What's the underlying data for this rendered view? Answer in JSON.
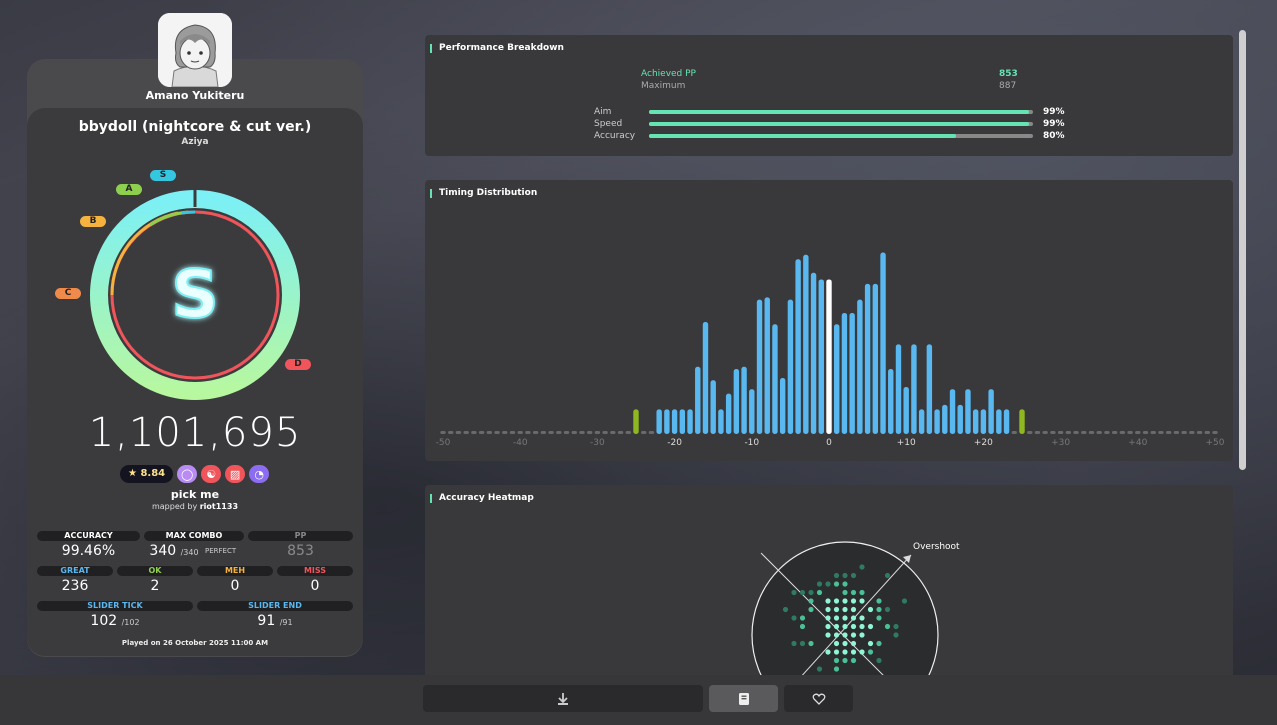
{
  "user": {
    "name": "Amano Yukiteru"
  },
  "beatmap": {
    "title": "bbydoll (nightcore & cut ver.)",
    "artist": "Aziya",
    "difficulty": "pick me",
    "mapped_by_prefix": "mapped by ",
    "mapper": "riot1133",
    "star_rating": "★ 8.84"
  },
  "grade": {
    "letter": "S",
    "labels": [
      "A",
      "S",
      "B",
      "C",
      "D"
    ],
    "colors": {
      "S": "#35c6e0",
      "A": "#8ed04e",
      "B": "#f5b23f",
      "C": "#f08a4b",
      "D": "#f0555b"
    }
  },
  "score": "1,101,695",
  "mods": [
    {
      "name": "mod-hidden-icon",
      "glyph": "◯",
      "color": "#b98cf5"
    },
    {
      "name": "mod-nightcore-icon",
      "glyph": "☯",
      "color": "#f0555b"
    },
    {
      "name": "mod-hardrock-icon",
      "glyph": "▨",
      "color": "#f0555b"
    },
    {
      "name": "mod-rate-icon",
      "glyph": "◔",
      "color": "#8c6cf0"
    }
  ],
  "stats": {
    "accuracy_label": "ACCURACY",
    "accuracy": "99.46%",
    "max_combo_label": "MAX COMBO",
    "max_combo": "340",
    "max_combo_total": "/340",
    "perfect_label": "PERFECT",
    "pp_label": "PP",
    "pp": "853",
    "great_label": "GREAT",
    "great": "236",
    "ok_label": "OK",
    "ok": "2",
    "meh_label": "MEH",
    "meh": "0",
    "miss_label": "MISS",
    "miss": "0",
    "slider_tick_label": "SLIDER TICK",
    "slider_tick": "102",
    "slider_tick_total": "/102",
    "slider_end_label": "SLIDER END",
    "slider_end": "91",
    "slider_end_total": "/91",
    "played_on": "Played on 26 October 2025 11:00 AM"
  },
  "performance": {
    "title": "Performance Breakdown",
    "achieved_label": "Achieved PP",
    "achieved": "853",
    "maximum_label": "Maximum",
    "maximum": "887",
    "bars": [
      {
        "label": "Aim",
        "value": 0.99,
        "text": "99%"
      },
      {
        "label": "Speed",
        "value": 0.99,
        "text": "99%"
      },
      {
        "label": "Accuracy",
        "value": 0.8,
        "text": "80%"
      }
    ]
  },
  "timing": {
    "title": "Timing Distribution"
  },
  "chart_data": {
    "type": "bar",
    "xlim": [
      -50,
      50
    ],
    "x_ticks": [
      "-50",
      "-40",
      "-30",
      "-20",
      "-10",
      "0",
      "+10",
      "+20",
      "+30",
      "+40",
      "+50"
    ],
    "x": [
      -25,
      -22,
      -21,
      -20,
      -19,
      -18,
      -17,
      -16,
      -15,
      -14,
      -13,
      -12,
      -11,
      -10,
      -9,
      -8,
      -7,
      -6,
      -5,
      -4,
      -3,
      -2,
      -1,
      0,
      1,
      2,
      3,
      4,
      5,
      6,
      7,
      8,
      9,
      10,
      11,
      12,
      13,
      14,
      15,
      16,
      17,
      18,
      19,
      20,
      21,
      22,
      23,
      25
    ],
    "values": [
      11,
      11,
      11,
      11,
      11,
      11,
      30,
      50,
      24,
      11,
      18,
      29,
      30,
      20,
      60,
      61,
      49,
      25,
      60,
      78,
      80,
      72,
      69,
      69,
      49,
      54,
      54,
      60,
      67,
      67,
      81,
      29,
      40,
      21,
      40,
      11,
      40,
      11,
      13,
      20,
      13,
      20,
      11,
      11,
      20,
      11,
      11,
      11
    ],
    "highlight": {
      "zero": "#ffffff",
      "edge": "#8fb820",
      "bar": "#5ab8f0"
    }
  },
  "heatmap": {
    "title": "Accuracy Heatmap",
    "overshoot_label": "Overshoot"
  },
  "bottom": {
    "download_icon": "download-icon",
    "info_icon": "notebook-icon",
    "favorite_icon": "heart-icon"
  }
}
